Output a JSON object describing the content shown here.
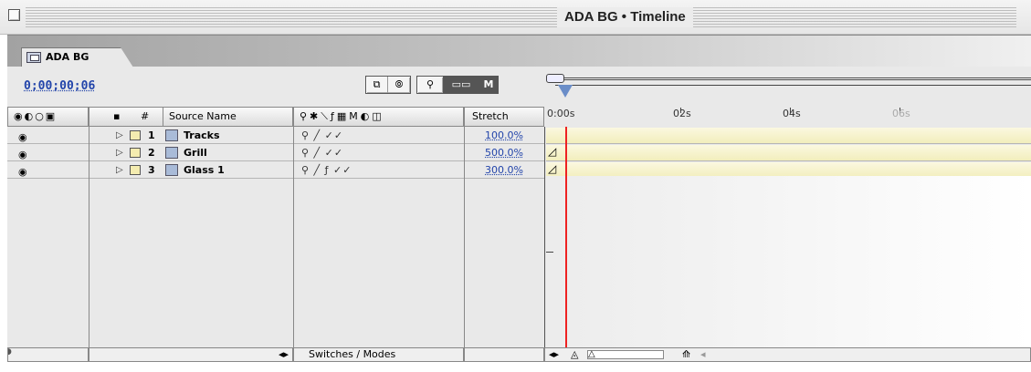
{
  "window": {
    "title": "ADA BG • Timeline"
  },
  "tab": {
    "label": "ADA BG"
  },
  "timecode": "0;00;00;06",
  "headers": {
    "source_name": "Source Name",
    "hash": "#",
    "stretch": "Stretch"
  },
  "ruler": {
    "ticks": [
      "0:00s",
      "02s",
      "04s",
      "06s"
    ]
  },
  "layers": [
    {
      "num": "1",
      "name": "Tracks",
      "stretch": "100.0%",
      "switches": "⚲   ╱     ✓✓"
    },
    {
      "num": "2",
      "name": "Grill",
      "stretch": "500.0%",
      "switches": "⚲   ╱     ✓✓"
    },
    {
      "num": "3",
      "name": "Glass 1",
      "stretch": "300.0%",
      "switches": "⚲   ╱  ƒ ✓✓"
    }
  ],
  "bottom": {
    "switches_modes": "Switches / Modes"
  },
  "colors": {
    "accent": "#2244aa",
    "label": "#f4ecb0",
    "cti": "#ee2222"
  }
}
